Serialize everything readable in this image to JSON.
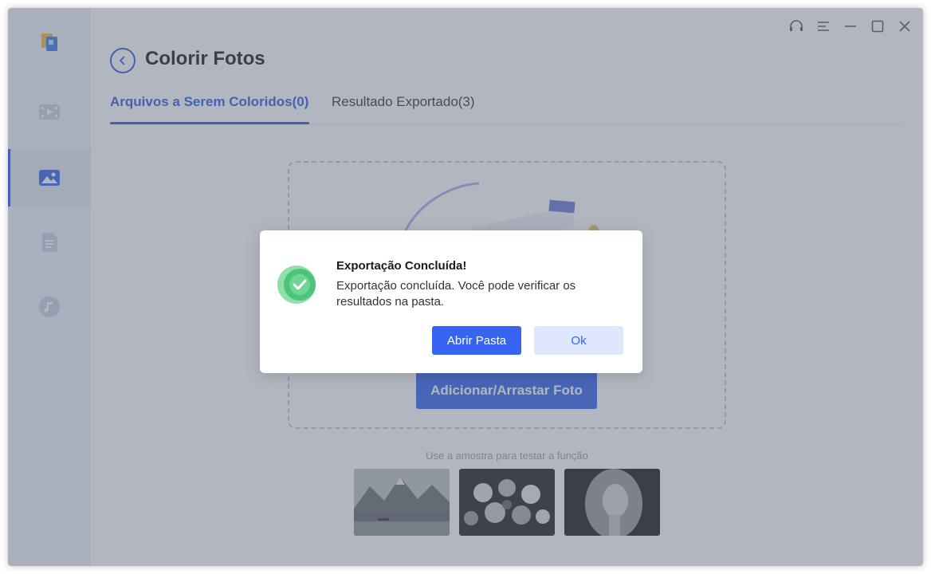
{
  "page": {
    "title": "Colorir Fotos"
  },
  "tabs": [
    {
      "label": "Arquivos a Serem Coloridos(0)"
    },
    {
      "label": "Resultado Exportado(3)"
    }
  ],
  "sidebar": {
    "items": [
      {
        "icon": "video-icon"
      },
      {
        "icon": "image-icon",
        "active": true
      },
      {
        "icon": "document-icon"
      },
      {
        "icon": "music-icon"
      }
    ]
  },
  "titlebar": {
    "icons": [
      "headset-icon",
      "menu-icon",
      "minimize-icon",
      "maximize-icon",
      "close-icon"
    ]
  },
  "main": {
    "add_button": "Adicionar/Arrastar Foto",
    "sample_caption": "Use a amostra para testar a função",
    "samples": [
      "mountain-lake-sample",
      "flowers-sample",
      "portrait-sample"
    ]
  },
  "dialog": {
    "title": "Exportação Concluída!",
    "message": "Exportação concluída. Você pode verificar os resultados na pasta.",
    "primary_button": "Abrir Pasta",
    "secondary_button": "Ok"
  },
  "colors": {
    "accent": "#3565f2",
    "success": "#4cc47a",
    "sidebar_bg": "#eef1f7"
  }
}
